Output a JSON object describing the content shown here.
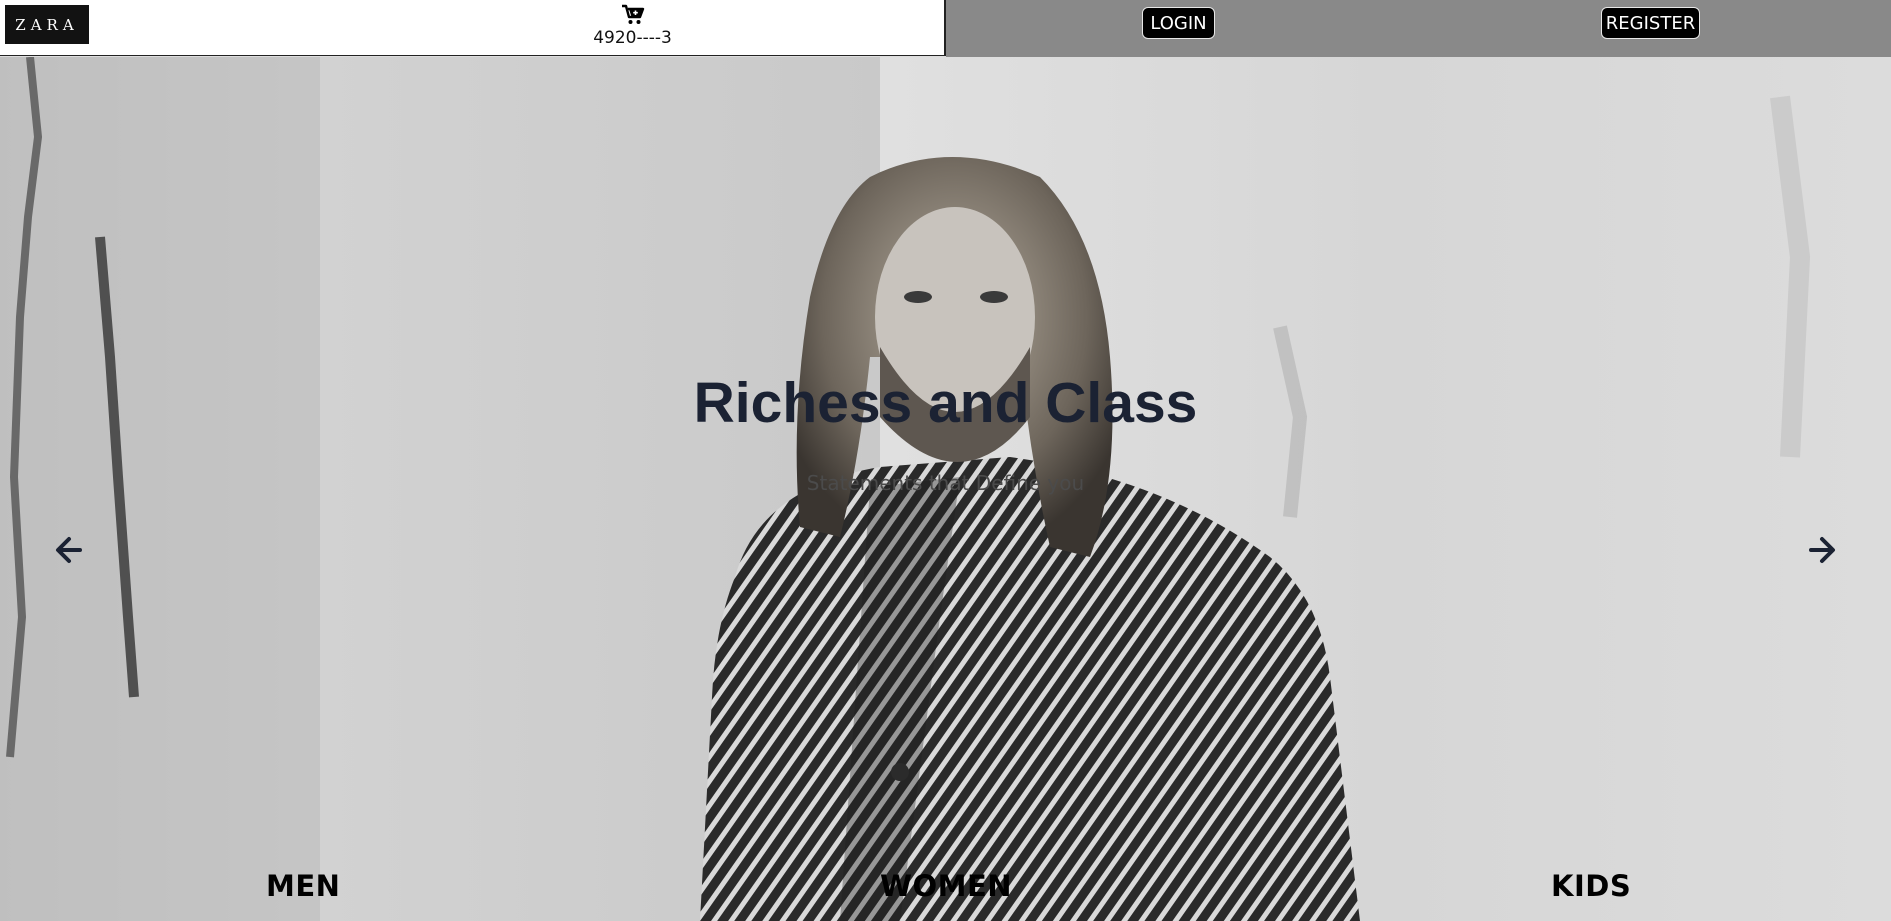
{
  "header": {
    "logo_text": "ZARA",
    "cart_icon": "cart-plus-icon",
    "cart_count": "4920----3",
    "login_label": "LOGIN",
    "register_label": "REGISTER"
  },
  "hero": {
    "title": "Richess and Class",
    "subtitle": "Statements that Define you",
    "prev_icon": "arrow-left-icon",
    "next_icon": "arrow-right-icon",
    "image": "black-and-white photo of long-haired bearded man in herringbone coat against a pale plaster wall"
  },
  "categories": [
    {
      "label": "MEN"
    },
    {
      "label": "WOMEN"
    },
    {
      "label": "KIDS"
    }
  ],
  "colors": {
    "header_left_bg": "#ffffff",
    "header_right_bg": "#898989",
    "button_bg": "#000000",
    "title_color": "#1b2233"
  }
}
